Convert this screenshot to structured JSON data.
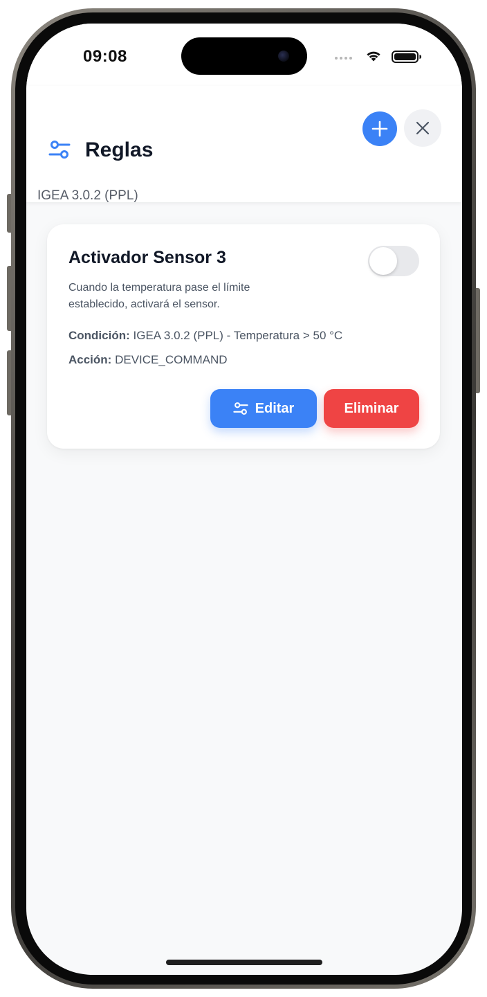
{
  "status_bar": {
    "time": "09:08",
    "wifi_icon": "wifi-icon",
    "battery_icon": "battery-icon"
  },
  "header": {
    "icon": "sliders-icon",
    "title": "Reglas",
    "subtitle": "IGEA 3.0.2 (PPL)",
    "add_icon": "plus-icon",
    "close_icon": "close-icon"
  },
  "rules": [
    {
      "name": "Activador Sensor 3",
      "enabled": false,
      "description": "Cuando la temperatura pase el límite establecido, activará el sensor.",
      "condition_label": "Condición:",
      "condition_value": "IGEA 3.0.2 (PPL) - Temperatura > 50 °C",
      "action_label": "Acción:",
      "action_value": "DEVICE_COMMAND",
      "edit_label": "Editar",
      "edit_icon": "sliders-icon",
      "delete_label": "Eliminar"
    }
  ],
  "colors": {
    "primary": "#3b82f6",
    "danger": "#ef4444",
    "background": "#f8f9fa"
  }
}
